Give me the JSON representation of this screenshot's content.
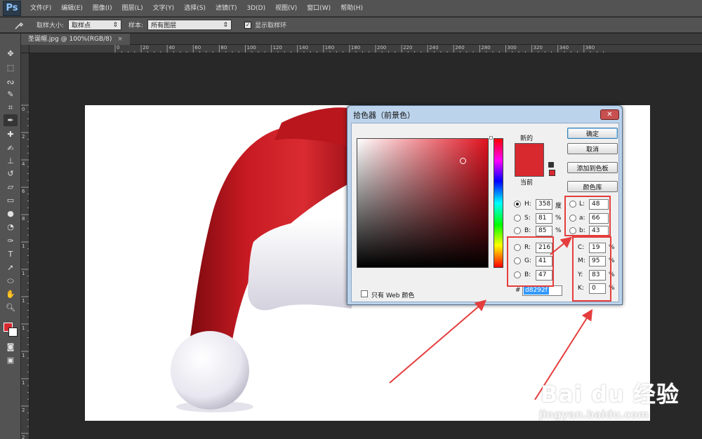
{
  "app": {
    "logo": "Ps",
    "menu": [
      "文件(F)",
      "编辑(E)",
      "图像(I)",
      "图层(L)",
      "文字(Y)",
      "选择(S)",
      "滤镜(T)",
      "3D(D)",
      "视图(V)",
      "窗口(W)",
      "帮助(H)"
    ]
  },
  "options": {
    "tool_icon": "eyedropper-icon",
    "sample_size_label": "取样大小:",
    "sample_size_value": "取样点",
    "sample_label": "样本:",
    "sample_value": "所有图层",
    "show_ring_label": "显示取样环",
    "show_ring_checked": true
  },
  "document": {
    "tab_title": "圣诞帽.jpg @ 100%(RGB/8)",
    "close": "×"
  },
  "rulers": {
    "top": [
      "0",
      "20",
      "40",
      "60",
      "80",
      "100",
      "120",
      "140",
      "160",
      "180",
      "200",
      "220",
      "240",
      "260",
      "280",
      "300",
      "320",
      "340",
      "360"
    ],
    "left": [
      "0",
      "2",
      "4",
      "6",
      "8",
      "1",
      "1",
      "1",
      "1",
      "1",
      "1",
      "2",
      "2"
    ]
  },
  "dialog": {
    "title": "拾色器（前景色）",
    "close": "✕",
    "new_label": "新的",
    "current_label": "当前",
    "new_color": "#d8292f",
    "buttons": {
      "ok": "确定",
      "cancel": "取消",
      "add_swatch": "添加到色板",
      "color_library": "颜色库"
    },
    "web_only_label": "只有 Web 颜色",
    "hsb": [
      {
        "label": "H:",
        "value": "358",
        "unit": "度"
      },
      {
        "label": "S:",
        "value": "81",
        "unit": "%"
      },
      {
        "label": "B:",
        "value": "85",
        "unit": "%"
      }
    ],
    "rgb": [
      {
        "label": "R:",
        "value": "216"
      },
      {
        "label": "G:",
        "value": "41"
      },
      {
        "label": "B:",
        "value": "47"
      }
    ],
    "lab": [
      {
        "label": "L:",
        "value": "48"
      },
      {
        "label": "a:",
        "value": "66"
      },
      {
        "label": "b:",
        "value": "43"
      }
    ],
    "cmyk": [
      {
        "label": "C:",
        "value": "19",
        "unit": "%"
      },
      {
        "label": "M:",
        "value": "95",
        "unit": "%"
      },
      {
        "label": "Y:",
        "value": "83",
        "unit": "%"
      },
      {
        "label": "K:",
        "value": "0",
        "unit": "%"
      }
    ],
    "hex_label": "#",
    "hex_value": "d8292f"
  },
  "watermark": {
    "brand": "Bai du 经验",
    "url": "jingyan.baidu.com"
  },
  "colors": {
    "accent_red": "#e53d3d",
    "picked": "#d8292f"
  }
}
